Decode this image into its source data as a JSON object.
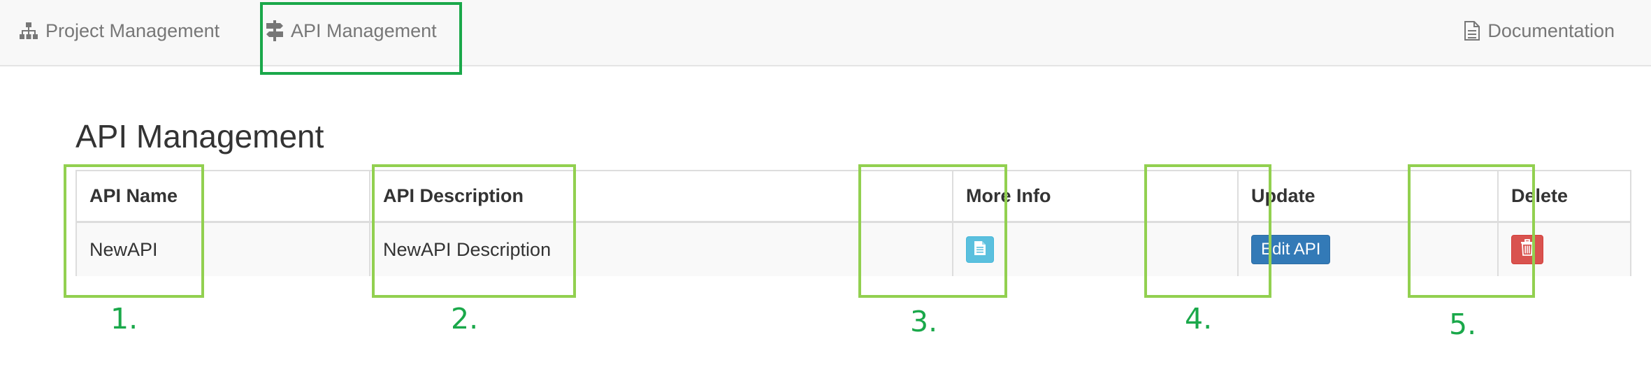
{
  "navbar": {
    "project_management": {
      "label": "Project Management",
      "icon": "sitemap-icon"
    },
    "api_management": {
      "label": "API Management",
      "icon": "signpost-icon"
    },
    "documentation": {
      "label": "Documentation",
      "icon": "file-icon"
    }
  },
  "page": {
    "title": "API Management"
  },
  "table": {
    "headers": [
      "API Name",
      "API Description",
      "More Info",
      "Update",
      "Delete"
    ],
    "rows": [
      {
        "name": "NewAPI",
        "description": "NewAPI Description",
        "more_info_icon": "file-text-icon",
        "update_label": "Edit API",
        "delete_icon": "trash-icon"
      }
    ]
  },
  "annotations": {
    "labels": [
      "1.",
      "2.",
      "3.",
      "4.",
      "5."
    ],
    "color": "#1aa84a",
    "box_color_light": "#92d050"
  },
  "colors": {
    "info_button": "#5bc0de",
    "primary_button": "#337ab7",
    "danger_button": "#d9534f",
    "navbar_bg": "#f8f8f8",
    "nav_text": "#777777"
  }
}
